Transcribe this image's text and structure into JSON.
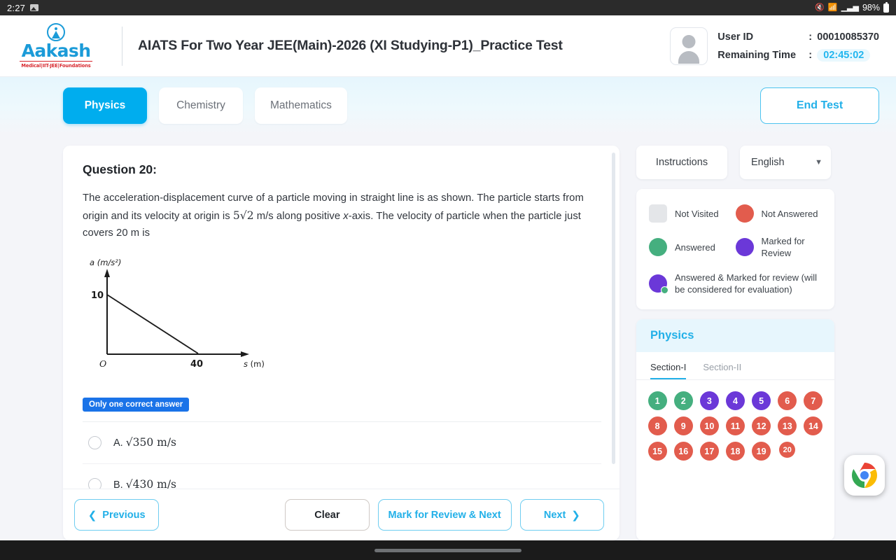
{
  "statusbar": {
    "time": "2:27",
    "battery": "98%"
  },
  "header": {
    "logo_word": "Aakash",
    "logo_tagline": "Medical|IIT-JEE|Foundations",
    "test_title": "AIATS For Two Year JEE(Main)-2026 (XI Studying-P1)_Practice Test",
    "user_id_label": "User ID",
    "user_id_value": "00010085370",
    "remaining_time_label": "Remaining Time",
    "remaining_time_value": "02:45:02",
    "colon": ":"
  },
  "tabs": {
    "items": [
      {
        "label": "Physics",
        "active": true
      },
      {
        "label": "Chemistry",
        "active": false
      },
      {
        "label": "Mathematics",
        "active": false
      }
    ],
    "end_test_label": "End Test"
  },
  "question": {
    "title": "Question 20:",
    "text_part1": "The acceleration-displacement curve of a particle moving in straight line is as shown. The particle starts from origin and its velocity at origin is ",
    "math1": "5√2",
    "text_part2": " m/s along positive ",
    "italic_x": "x",
    "text_part3": "-axis. The velocity of particle when the particle just covers 20 m is",
    "badge": "Only one correct answer",
    "options": [
      {
        "key": "A.",
        "value": "√350 m/s",
        "selected": false
      },
      {
        "key": "B.",
        "value": "√430 m/s",
        "selected": false
      }
    ]
  },
  "chart_data": {
    "type": "line",
    "title": "",
    "xlabel": "s (m)",
    "ylabel": "a (m/s²)",
    "origin_label": "O",
    "x": [
      0,
      40
    ],
    "y": [
      10,
      0
    ],
    "xticks": [
      "40"
    ],
    "yticks": [
      "10"
    ],
    "xlim": [
      0,
      55
    ],
    "ylim": [
      0,
      12
    ],
    "grid": false,
    "legend": "none"
  },
  "footer": {
    "previous": "Previous",
    "clear": "Clear",
    "mark_review_next": "Mark for Review & Next",
    "next": "Next"
  },
  "right": {
    "instructions": "Instructions",
    "language": "English",
    "legend": [
      {
        "label": "Not Visited",
        "color": "#e4e6e9",
        "shape": "square"
      },
      {
        "label": "Not Answered",
        "color": "#e25c4d",
        "shape": "circle"
      },
      {
        "label": "Answered",
        "color": "#45af7f",
        "shape": "circle"
      },
      {
        "label": "Marked for Review",
        "color": "#6b38d8",
        "shape": "circle"
      },
      {
        "label": "Answered & Marked for review (will be considered for evaluation)",
        "color": "#6b38d8",
        "shape": "combo"
      }
    ],
    "palette_title": "Physics",
    "sections": [
      {
        "label": "Section-I",
        "active": true
      },
      {
        "label": "Section-II",
        "active": false
      }
    ],
    "questions": [
      {
        "n": "1",
        "state": "answered"
      },
      {
        "n": "2",
        "state": "answered"
      },
      {
        "n": "3",
        "state": "marked"
      },
      {
        "n": "4",
        "state": "marked"
      },
      {
        "n": "5",
        "state": "marked"
      },
      {
        "n": "6",
        "state": "not-answered"
      },
      {
        "n": "7",
        "state": "not-answered"
      },
      {
        "n": "8",
        "state": "not-answered"
      },
      {
        "n": "9",
        "state": "not-answered"
      },
      {
        "n": "10",
        "state": "not-answered"
      },
      {
        "n": "11",
        "state": "not-answered"
      },
      {
        "n": "12",
        "state": "not-answered"
      },
      {
        "n": "13",
        "state": "not-answered"
      },
      {
        "n": "14",
        "state": "not-answered"
      },
      {
        "n": "15",
        "state": "not-answered"
      },
      {
        "n": "16",
        "state": "not-answered"
      },
      {
        "n": "17",
        "state": "not-answered"
      },
      {
        "n": "18",
        "state": "not-answered"
      },
      {
        "n": "19",
        "state": "not-answered"
      },
      {
        "n": "20",
        "state": "not-answered",
        "current": true
      }
    ]
  },
  "colors": {
    "accent": "#00adee",
    "answered": "#45af7f",
    "marked": "#6b38d8",
    "not_answered": "#e25c4d",
    "not_visited": "#e4e6e9"
  },
  "floating": {
    "chrome": "chrome-icon"
  }
}
